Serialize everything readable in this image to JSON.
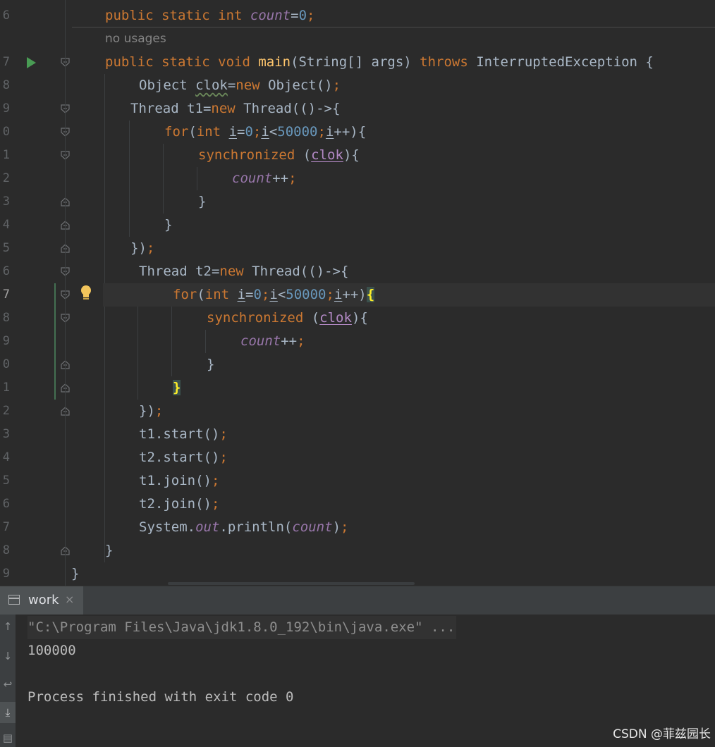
{
  "editor": {
    "hint_text": "no usages",
    "line_numbers": [
      "6",
      "7",
      "8",
      "9",
      "0",
      "1",
      "2",
      "3",
      "4",
      "5",
      "6",
      "7",
      "8",
      "9",
      "0",
      "1",
      "2",
      "3",
      "4",
      "5",
      "6",
      "7",
      "8",
      "9"
    ]
  },
  "code": {
    "l6": {
      "kw1": "public static int ",
      "fld": "count",
      "op": "=",
      "num": "0",
      "semi": ";"
    },
    "l7": {
      "kw1": "public static void ",
      "fn": "main",
      "t1": "(String[] args) ",
      "kw2": "throws",
      "t2": " InterruptedException {"
    },
    "l8": {
      "t1": "Object ",
      "var": "clok",
      "t2": "=",
      "kw": "new",
      "t3": " Object()",
      "semi": ";"
    },
    "l9": {
      "t1": "Thread t1=",
      "kw": "new",
      "t2": " Thread(()->{"
    },
    "l10": {
      "kw1": "for",
      "t1": "(",
      "kw2": "int",
      "t2": " ",
      "v1": "i",
      "t3": "=",
      "n1": "0",
      "s1": ";",
      "v2": "i",
      "t4": "<",
      "n2": "50000",
      "s2": ";",
      "v3": "i",
      "t5": "++){"
    },
    "l11": {
      "kw": "synchronized",
      "t1": " (",
      "var": "clok",
      "t2": "){"
    },
    "l12": {
      "fld": "count",
      "t1": "++",
      "semi": ";"
    },
    "l13": {
      "t1": "}"
    },
    "l14": {
      "t1": "}"
    },
    "l15": {
      "t1": "})",
      "semi": ";"
    },
    "l16": {
      "t1": "Thread t2=",
      "kw": "new",
      "t2": " Thread(()->{"
    },
    "l17": {
      "kw1": "for",
      "t1": "(",
      "kw2": "int",
      "t2": " ",
      "v1": "i",
      "t3": "=",
      "n1": "0",
      "s1": ";",
      "v2": "i",
      "t4": "<",
      "n2": "50000",
      "s2": ";",
      "v3": "i",
      "t5": "++)",
      "brace": "{"
    },
    "l18": {
      "kw": "synchronized",
      "t1": " (",
      "var": "clok",
      "t2": "){"
    },
    "l19": {
      "fld": "count",
      "t1": "++",
      "semi": ";"
    },
    "l20": {
      "t1": "}"
    },
    "l21": {
      "brace": "}"
    },
    "l22": {
      "t1": "})",
      "semi": ";"
    },
    "l23": {
      "t1": "t1.start()",
      "semi": ";"
    },
    "l24": {
      "t1": "t2.start()",
      "semi": ";"
    },
    "l25": {
      "t1": "t1.join()",
      "semi": ";"
    },
    "l26": {
      "t1": "t2.join()",
      "semi": ";"
    },
    "l27": {
      "t1": "System.",
      "fld1": "out",
      "t2": ".println(",
      "fld2": "count",
      "t3": ")",
      "semi": ";"
    },
    "l28": {
      "t1": "}"
    },
    "l29": {
      "t1": "}"
    }
  },
  "run_panel": {
    "tab_label": "work",
    "tab_close": "×",
    "output": [
      "\"C:\\Program Files\\Java\\jdk1.8.0_192\\bin\\java.exe\" ...",
      "100000",
      "",
      "Process finished with exit code 0"
    ]
  },
  "watermark": "CSDN @菲兹园长",
  "colors": {
    "background": "#2b2b2b",
    "keyword": "#cc7832",
    "number": "#6897bb",
    "field": "#9876aa",
    "method": "#ffc66d",
    "run_icon": "#499c54",
    "bulb": "#f2c55c"
  },
  "icons": [
    "run-gutter-icon",
    "lightbulb-icon",
    "fold-icon",
    "console-tab-icon",
    "close-icon",
    "arrow-up-icon",
    "arrow-down-icon",
    "soft-wrap-icon",
    "scroll-to-end-icon",
    "print-icon"
  ]
}
